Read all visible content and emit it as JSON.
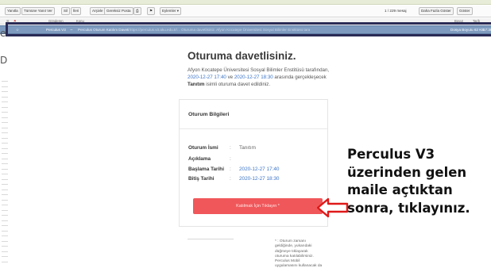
{
  "toolbar": {
    "buttons": [
      "Yanıtla",
      "Tümüne Yanıt Ver",
      "Sil",
      "İleri",
      "Arşivle",
      "Gereksiz Posta",
      "Eylemler ▾"
    ],
    "message_count": "1 / 229 mesaj",
    "right_buttons": [
      "Daha Fazla Göster",
      "Göster"
    ]
  },
  "columns": {
    "from": "Gönderen",
    "subject": "Konu",
    "size": "Boyut",
    "date": "Tarih"
  },
  "mail_row": {
    "from": "Perculus V3",
    "subject": "Perculus Oturum Katılım Daveti",
    "preview": "- https://perculus.v3.aku.edu.tr/... Oturuma davetlisiniz. Afyon Kocatepe Üniversitesi Sosyal Bilimler Enstitüsü tarafından 2020-12-27 17:40 ve ...",
    "size": "Dosya Boyutu 62 KB",
    "time": "17:38"
  },
  "email": {
    "headline": "Oturuma davetlisiniz.",
    "invite_prefix": "Afyon Kocatepe Üniversitesi Sosyal Bilimler Enstitüsü tarafından,",
    "invite_start": "2020-12-27 17:40",
    "invite_and": " ve ",
    "invite_end": "2020-12-27 18:30",
    "invite_between": " arasında gerçekleşecek",
    "invite_session": "Tanıtım",
    "invite_suffix": " isimli oturuma davet edildiniz.",
    "card_title": "Oturum Bilgileri",
    "fields": [
      {
        "label": "Oturum İsmi",
        "value": "Tanıtım"
      },
      {
        "label": "Açıklama",
        "value": ""
      },
      {
        "label": "Başlama Tarihi",
        "value": "2020-12-27 17:40"
      },
      {
        "label": "Bitiş Tarihi",
        "value": "2020-12-27 18:30"
      }
    ],
    "join_button": "Katılmak İçin Tıklayın *",
    "footnote": "* : Oturum zamanı geldiğinde, yukarıdaki düğmeye tıklayarak oturuma katılabilirsiniz. Perculus Mobil uygulamasını kullanacak da bu düğmeye"
  },
  "annotation": {
    "lines": [
      "Perculus V3",
      "üzerinden gelen",
      "maile açtıktan",
      "sonra, tıklayınız."
    ]
  },
  "colors": {
    "row_selected": "#7e9bbf",
    "highlight": "#2b2b56",
    "join_button": "#f0575a",
    "link_blue": "#3b74c8",
    "arrow_red": "#e01919"
  }
}
